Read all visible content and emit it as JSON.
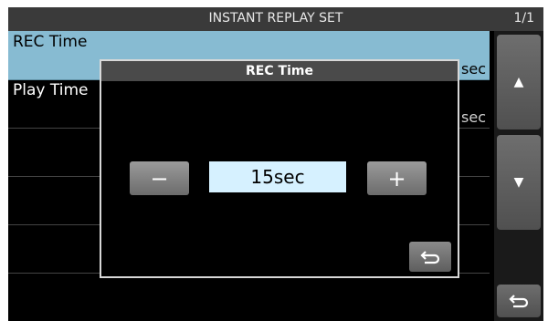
{
  "header": {
    "title": "INSTANT REPLAY SET",
    "page": "1/1"
  },
  "list": {
    "items": [
      {
        "label": "REC Time",
        "value": "sec"
      },
      {
        "label": "Play Time",
        "value": "sec"
      }
    ]
  },
  "sidebar": {
    "up_icon": "triangle-up-icon",
    "down_icon": "triangle-down-icon",
    "back_icon": "return-arrow-icon"
  },
  "dialog": {
    "title": "REC Time",
    "minus_label": "−",
    "plus_label": "+",
    "value": "15sec",
    "back_icon": "return-arrow-icon"
  },
  "colors": {
    "selected_row": "#87bbd2",
    "value_box": "#d6f1ff"
  }
}
